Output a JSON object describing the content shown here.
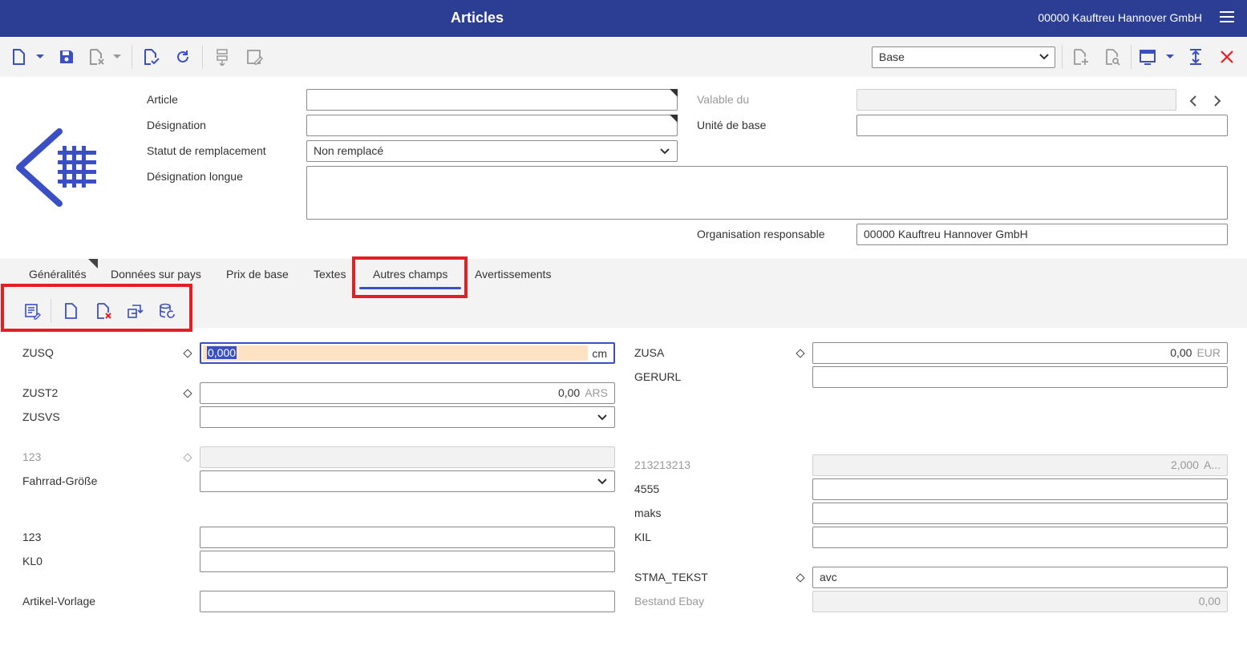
{
  "app": {
    "title": "Articles",
    "organization": "00000  Kauftreu Hannover GmbH"
  },
  "toolbar": {
    "view_select": "Base",
    "icons": [
      "new-document-icon",
      "chevron-down-icon",
      "save-icon",
      "discard-icon",
      "chevron-down-icon",
      "validate-icon",
      "refresh-icon",
      "structure-icon",
      "edit-form-icon",
      "new-page-icon",
      "search-document-icon",
      "window-icon",
      "chevron-down-icon",
      "fit-height-icon",
      "close-icon"
    ]
  },
  "header": {
    "article_label": "Article",
    "article_value": "",
    "designation_label": "Désignation",
    "designation_value": "",
    "status_label": "Statut de remplacement",
    "status_value": "Non remplacé",
    "long_designation_label": "Désignation longue",
    "long_designation_value": "",
    "valid_from_label": "Valable du",
    "valid_from_value": "",
    "base_unit_label": "Unité de base",
    "base_unit_value": "",
    "org_label": "Organisation responsable",
    "org_value": "00000 Kauftreu Hannover GmbH"
  },
  "tabs": [
    {
      "label": "Généralités"
    },
    {
      "label": "Données sur pays"
    },
    {
      "label": "Prix de base"
    },
    {
      "label": "Textes"
    },
    {
      "label": "Autres champs"
    },
    {
      "label": "Avertissements"
    }
  ],
  "active_tab": "Autres champs",
  "subtoolbar": {
    "icons": [
      "edit-list-icon",
      "new-document-icon",
      "delete-document-icon",
      "transfer-icon",
      "database-refresh-icon"
    ]
  },
  "left_fields": {
    "zusq_label": "ZUSQ",
    "zusq_value": "0,000",
    "zusq_unit": "cm",
    "zust2_label": "ZUST2",
    "zust2_value": "0,00",
    "zust2_unit": "ARS",
    "zusvs_label": "ZUSVS",
    "zusvs_value": "",
    "f123a_label": "123",
    "f123a_value": "",
    "fahrrad_label": "Fahrrad-Größe",
    "fahrrad_value": "",
    "f123b_label": "123",
    "f123b_value": "",
    "kl0_label": "KL0",
    "kl0_value": "",
    "vorlage_label": "Artikel-Vorlage",
    "vorlage_value": ""
  },
  "right_fields": {
    "zusa_label": "ZUSA",
    "zusa_value": "0,00",
    "zusa_unit": "EUR",
    "gerurl_label": "GERURL",
    "gerurl_value": "",
    "f213_label": "213213213",
    "f213_value": "2,000",
    "f213_unit": "A...",
    "f4555_label": "4555",
    "f4555_value": "",
    "maks_label": "maks",
    "maks_value": "",
    "kil_label": "KIL",
    "kil_value": "",
    "stma_label": "STMA_TEKST",
    "stma_value": "avc",
    "ebay_label": "Bestand Ebay",
    "ebay_value": "0,00"
  },
  "colors": {
    "titlebar": "#2c3e94",
    "accent": "#3b4fc4",
    "highlight": "#e31e24",
    "selected_field": "#fde3c4"
  }
}
